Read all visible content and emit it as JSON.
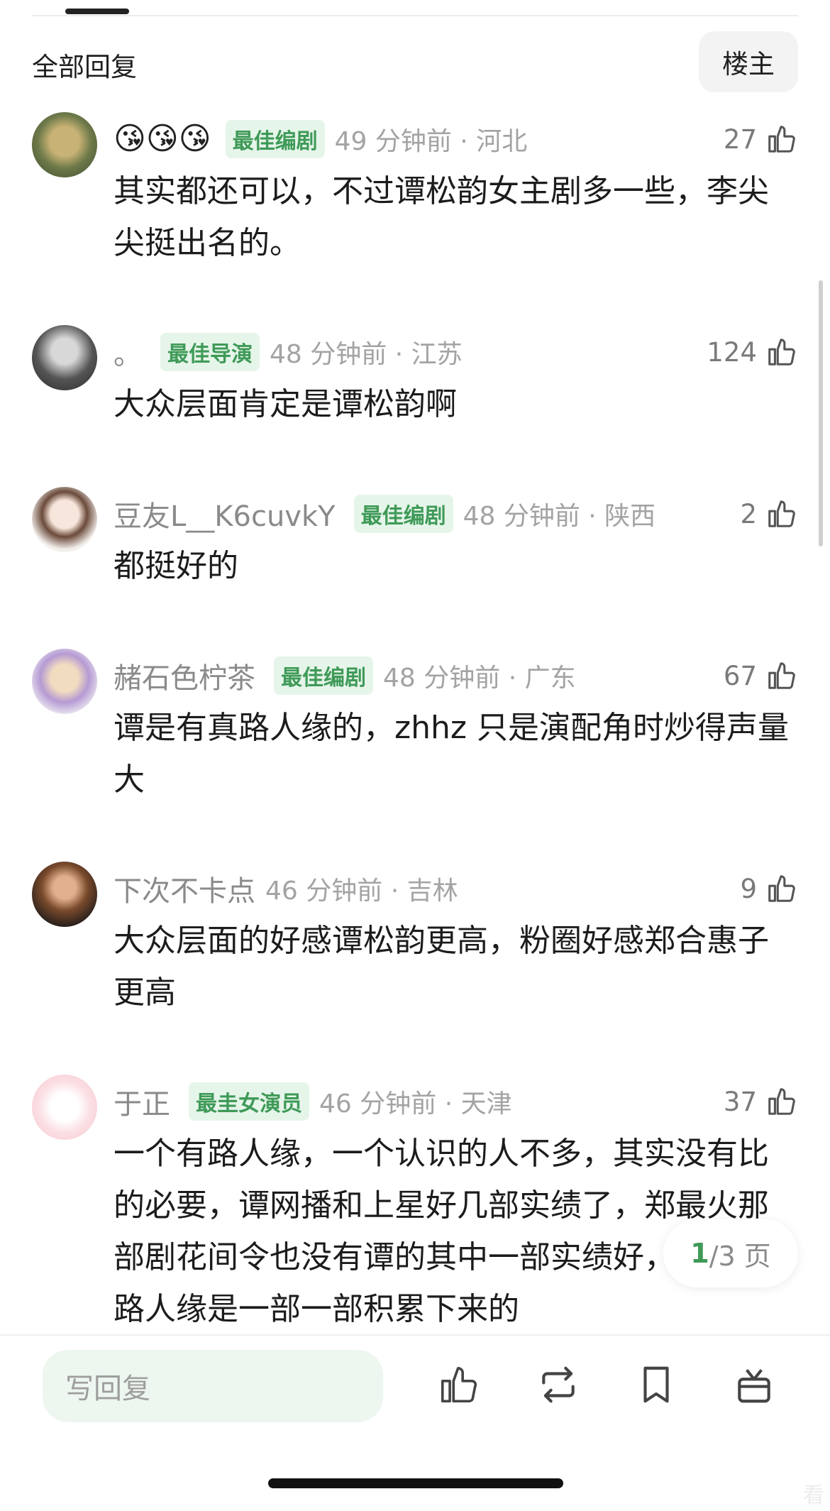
{
  "header": {
    "title": "全部回复",
    "op_button": "楼主"
  },
  "comments": [
    {
      "name": "",
      "emojis": "😘😘😘",
      "badge": "最佳编剧",
      "time": "49 分钟前 · 河北",
      "likes": "27",
      "text": "其实都还可以，不过谭松韵女主剧多一些，李尖尖挺出名的。"
    },
    {
      "name": "。",
      "emojis": "",
      "badge": "最佳导演",
      "time": "48 分钟前 · 江苏",
      "likes": "124",
      "text": "大众层面肯定是谭松韵啊"
    },
    {
      "name": "豆友L__K6cuvkY",
      "emojis": "",
      "badge": "最佳编剧",
      "time": "48 分钟前 · 陕西",
      "likes": "2",
      "text": "都挺好的"
    },
    {
      "name": "赭石色柠茶",
      "emojis": "",
      "badge": "最佳编剧",
      "time": "48 分钟前 · 广东",
      "likes": "67",
      "text": "谭是有真路人缘的，zhhz 只是演配角时炒得声量大"
    },
    {
      "name": "下次不卡点",
      "emojis": "",
      "badge": "",
      "time": "46 分钟前 · 吉林",
      "likes": "9",
      "text": "大众层面的好感谭松韵更高，粉圈好感郑合惠子更高"
    },
    {
      "name": "于正",
      "emojis": "",
      "badge": "最圭女演员",
      "time": "46 分钟前 · 天津",
      "likes": "37",
      "text": "一个有路人缘，一个认识的人不多，其实没有比的必要，谭网播和上星好几部实绩了，郑最火那部剧花间令也没有谭的其中一部实绩好，剧花的路人缘是一部一部积累下来的"
    }
  ],
  "pager": {
    "current": "1",
    "total_text": "/3 页"
  },
  "bottom_bar": {
    "reply_placeholder": "写回复"
  },
  "watermark": "看"
}
